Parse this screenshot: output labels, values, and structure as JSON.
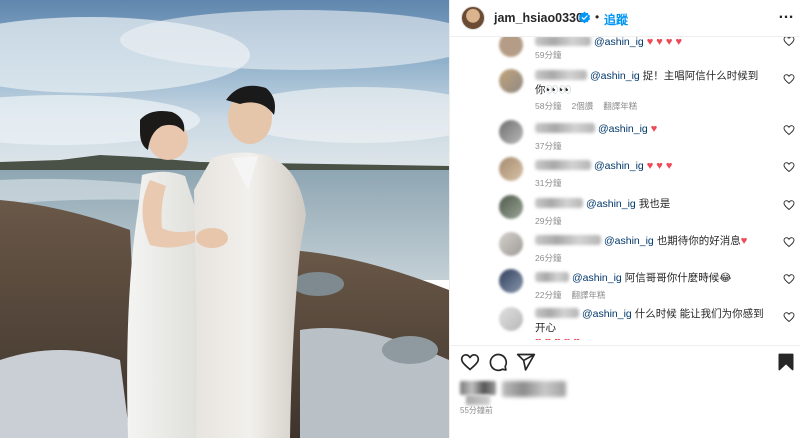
{
  "post": {
    "username": "jam_hsiao0330",
    "separator": "•",
    "follow_label": "追蹤",
    "more_label": "…",
    "time_ago": "55分鐘前"
  },
  "comments": [
    {
      "text_pre": "",
      "mention": "@ashin_ig",
      "text_post": "",
      "hearts": "♥ ♥ ♥ ♥",
      "time": "59分鐘",
      "extra": []
    },
    {
      "text_pre": "",
      "mention": "@ashin_ig",
      "text_post": " 捉！主唱阿信什么时候到你👀👀",
      "hearts": "",
      "time": "58分鐘",
      "extra": [
        "2個讚",
        "翻譯年糕"
      ]
    },
    {
      "text_pre": "",
      "mention": "@ashin_ig",
      "text_post": "",
      "hearts": "♥",
      "time": "37分鐘",
      "extra": []
    },
    {
      "text_pre": "",
      "mention": "@ashin_ig",
      "text_post": "",
      "hearts": "♥ ♥ ♥",
      "time": "31分鐘",
      "extra": []
    },
    {
      "text_pre": "",
      "mention": "@ashin_ig",
      "text_post": " 我也是",
      "hearts": "",
      "time": "29分鐘",
      "extra": []
    },
    {
      "text_pre": "",
      "mention": "@ashin_ig",
      "text_post": " 也期待你的好消息",
      "hearts": "♥",
      "time": "26分鐘",
      "extra": []
    },
    {
      "text_pre": "",
      "mention": "@ashin_ig",
      "text_post": " 阿信哥哥你什麼時候😂",
      "hearts": "",
      "time": "22分鐘",
      "extra": [
        "翻譯年糕"
      ]
    },
    {
      "text_pre": "",
      "mention": "@ashin_ig",
      "text_post": " 什么时候 能让我们为你感到开心",
      "hearts": "♥ ♥ ♥ ♥ ♥",
      "time": "",
      "extra": []
    }
  ],
  "colors": {
    "link": "#00376b",
    "follow": "#0095f6",
    "heart": "#ed4956",
    "muted": "#8e8e8e",
    "verified": "#0095f6"
  },
  "icons": [
    "heart-icon",
    "comment-icon",
    "share-icon",
    "bookmark-icon",
    "verified-badge-icon",
    "more-options-icon"
  ]
}
